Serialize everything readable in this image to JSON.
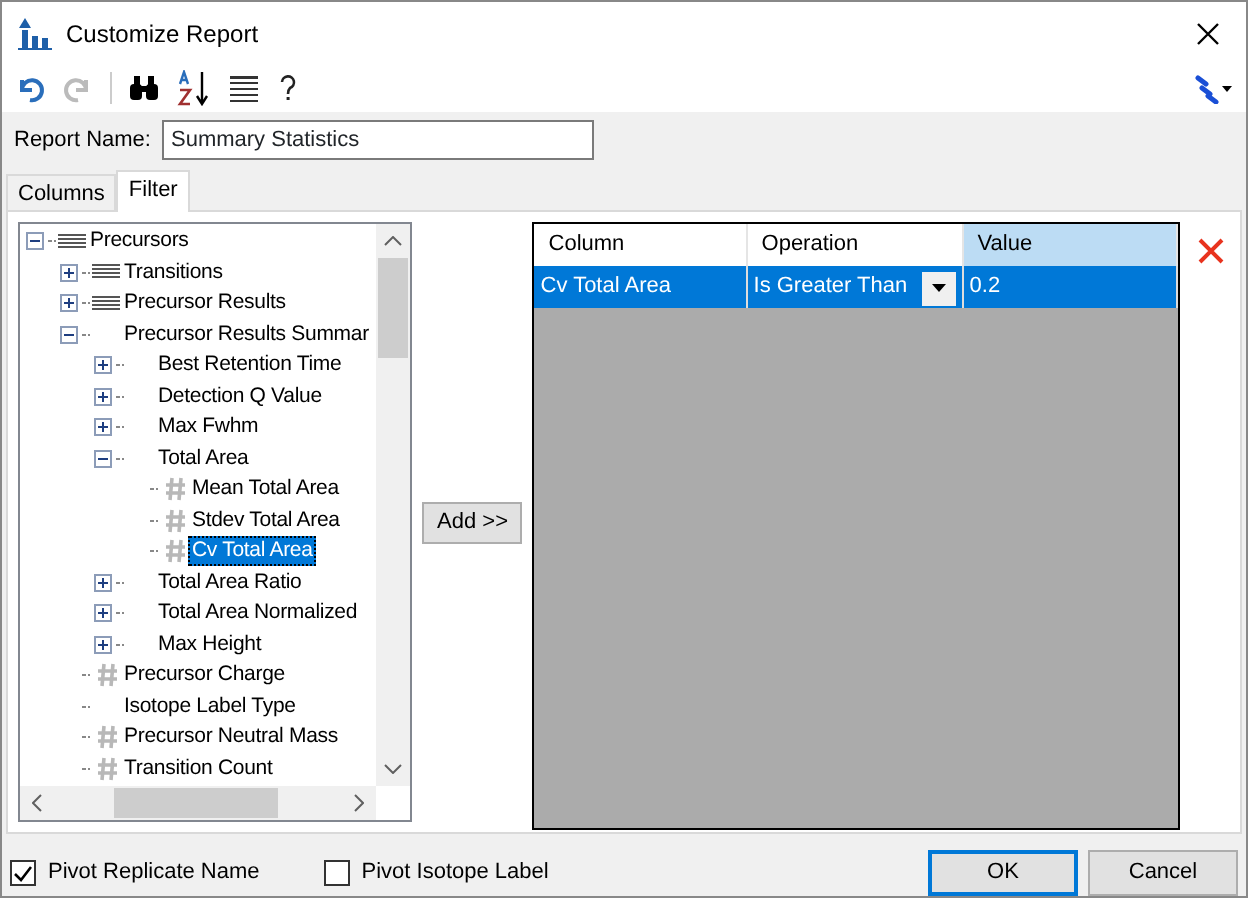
{
  "window": {
    "title": "Customize Report"
  },
  "report_name": {
    "label": "Report Name:",
    "value": "Summary Statistics"
  },
  "tabs": [
    {
      "label": "Columns",
      "selected": false
    },
    {
      "label": "Filter",
      "selected": true
    }
  ],
  "tree": [
    {
      "label": "Precursors",
      "kind": "table",
      "expanded": true,
      "selected": false,
      "children": [
        {
          "label": "Transitions",
          "kind": "table",
          "expanded": false,
          "selected": false
        },
        {
          "label": "Precursor Results",
          "kind": "table",
          "expanded": false,
          "selected": false
        },
        {
          "label": "Precursor Results Summar",
          "expanded": true,
          "selected": false,
          "children": [
            {
              "label": "Best Retention Time",
              "expanded": false,
              "selected": false
            },
            {
              "label": "Detection Q Value",
              "expanded": false,
              "selected": false
            },
            {
              "label": "Max Fwhm",
              "expanded": false,
              "selected": false
            },
            {
              "label": "Total Area",
              "expanded": true,
              "selected": false,
              "children": [
                {
                  "label": "Mean Total Area",
                  "kind": "number",
                  "selected": false
                },
                {
                  "label": "Stdev Total Area",
                  "kind": "number",
                  "selected": false
                },
                {
                  "label": "Cv Total Area",
                  "kind": "number",
                  "selected": true
                }
              ]
            },
            {
              "label": "Total Area Ratio",
              "expanded": false,
              "selected": false
            },
            {
              "label": "Total Area Normalized",
              "expanded": false,
              "selected": false
            },
            {
              "label": "Max Height",
              "expanded": false,
              "selected": false
            }
          ]
        },
        {
          "label": "Precursor Charge",
          "kind": "number",
          "selected": false
        },
        {
          "label": "Isotope Label Type",
          "selected": false
        },
        {
          "label": "Precursor Neutral Mass",
          "kind": "number",
          "selected": false
        },
        {
          "label": "Transition Count",
          "kind": "number",
          "selected": false
        }
      ]
    }
  ],
  "add_button": "Add >>",
  "filter_grid": {
    "columns": [
      {
        "label": "Column",
        "selected": false
      },
      {
        "label": "Operation",
        "selected": false
      },
      {
        "label": "Value",
        "selected": true
      }
    ],
    "rows": [
      {
        "column": "Cv Total Area",
        "operation": "Is Greater Than",
        "value": "0.2",
        "selected": true
      }
    ]
  },
  "options": [
    {
      "label": "Pivot Replicate Name",
      "checked": true
    },
    {
      "label": "Pivot Isotope Label",
      "checked": false
    }
  ],
  "buttons": [
    {
      "label": "OK",
      "default": true
    },
    {
      "label": "Cancel",
      "default": false
    }
  ]
}
